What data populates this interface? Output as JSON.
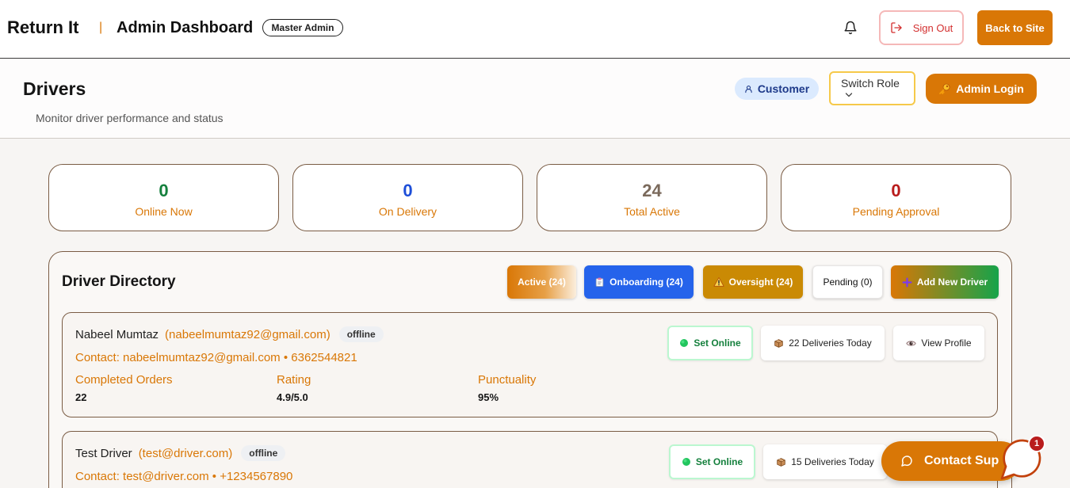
{
  "header": {
    "brand": "Return It",
    "divider": "|",
    "title": "Admin Dashboard",
    "role_badge": "Master Admin",
    "sign_out": "Sign Out",
    "back_to_site": "Back to Site"
  },
  "page_header": {
    "title": "Drivers",
    "subtitle": "Monitor driver performance and status",
    "current_role": "Customer",
    "switch_role": "Switch Role",
    "admin_login": "Admin Login"
  },
  "stats": [
    {
      "value": "0",
      "label": "Online Now",
      "color": "#15803d"
    },
    {
      "value": "0",
      "label": "On Delivery",
      "color": "#1d4ed8"
    },
    {
      "value": "24",
      "label": "Total Active",
      "color": "#7b6a5c"
    },
    {
      "value": "0",
      "label": "Pending Approval",
      "color": "#b91c1c"
    }
  ],
  "directory": {
    "title": "Driver Directory",
    "filters": [
      {
        "label": "Active (24)"
      },
      {
        "label": "Onboarding (24)",
        "icon": "clipboard-icon"
      },
      {
        "label": "Oversight (24)",
        "icon": "warning-icon"
      },
      {
        "label": "Pending (0)"
      }
    ],
    "add_driver": {
      "label": "Add New Driver",
      "icon": "plus-icon"
    },
    "drivers": [
      {
        "name": "Nabeel Mumtaz",
        "email": "(nabeelmumtaz92@gmail.com)",
        "status": "offline",
        "contact": "Contact: nabeelmumtaz92@gmail.com • 6362544821",
        "metrics": [
          {
            "label": "Completed Orders",
            "value": "22"
          },
          {
            "label": "Rating",
            "value": "4.9/5.0"
          },
          {
            "label": "Punctuality",
            "value": "95%"
          }
        ],
        "actions": {
          "set_online": "Set Online",
          "deliveries": "22 Deliveries Today",
          "view_profile": "View Profile"
        }
      },
      {
        "name": "Test Driver",
        "email": "(test@driver.com)",
        "status": "offline",
        "contact": "Contact: test@driver.com • +1234567890",
        "actions": {
          "set_online": "Set Online",
          "deliveries": "15 Deliveries Today"
        }
      }
    ]
  },
  "support_chat": {
    "label": "Contact Sup",
    "unread_count": "1"
  },
  "colors": {
    "accent": "#d97706",
    "online": "#15803d",
    "on_delivery": "#1d4ed8",
    "total_active": "#7b6a5c",
    "pending": "#b91c1c",
    "onboarding": "#2563eb",
    "oversight": "#ca8a04",
    "add_driver_end": "#16a34a",
    "role_chip_bg": "#dbeafe"
  },
  "icons": {
    "notifications": "bell-icon",
    "sign_out": "sign-out-icon",
    "current_role": "user-icon",
    "switch_role": "chevron-down-icon",
    "admin_login": "key-icon",
    "onboarding": "clipboard-icon",
    "oversight": "warning-icon",
    "add_driver": "plus-icon",
    "set_online": "green-dot-icon",
    "deliveries": "package-icon",
    "view_profile": "eye-icon",
    "support": "chat-icon"
  }
}
